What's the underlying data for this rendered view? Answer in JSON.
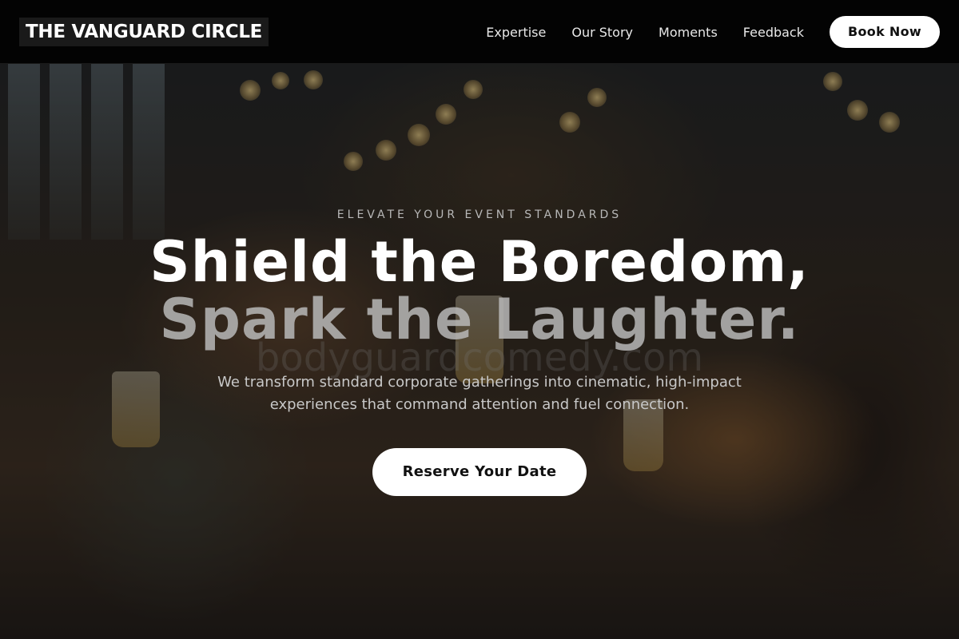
{
  "header": {
    "logo_text": "THE VANGUARD CIRCLE",
    "nav": [
      {
        "label": "Expertise"
      },
      {
        "label": "Our Story"
      },
      {
        "label": "Moments"
      },
      {
        "label": "Feedback"
      }
    ],
    "cta_label": "Book Now"
  },
  "hero": {
    "eyebrow": "ELEVATE YOUR EVENT STANDARDS",
    "headline_line1": "Shield the Boredom,",
    "headline_line2": "Spark the Laughter.",
    "watermark": "bodyguardcomedy.com",
    "subtext": "We transform standard corporate gatherings into cinematic, high-impact experiences that command attention and fuel connection.",
    "cta_label": "Reserve Your Date"
  },
  "colors": {
    "header_background": "#030303",
    "primary_button": "#ffffff",
    "button_text": "#111111",
    "headline_primary": "#ffffff",
    "headline_secondary": "#b9b9b9"
  }
}
